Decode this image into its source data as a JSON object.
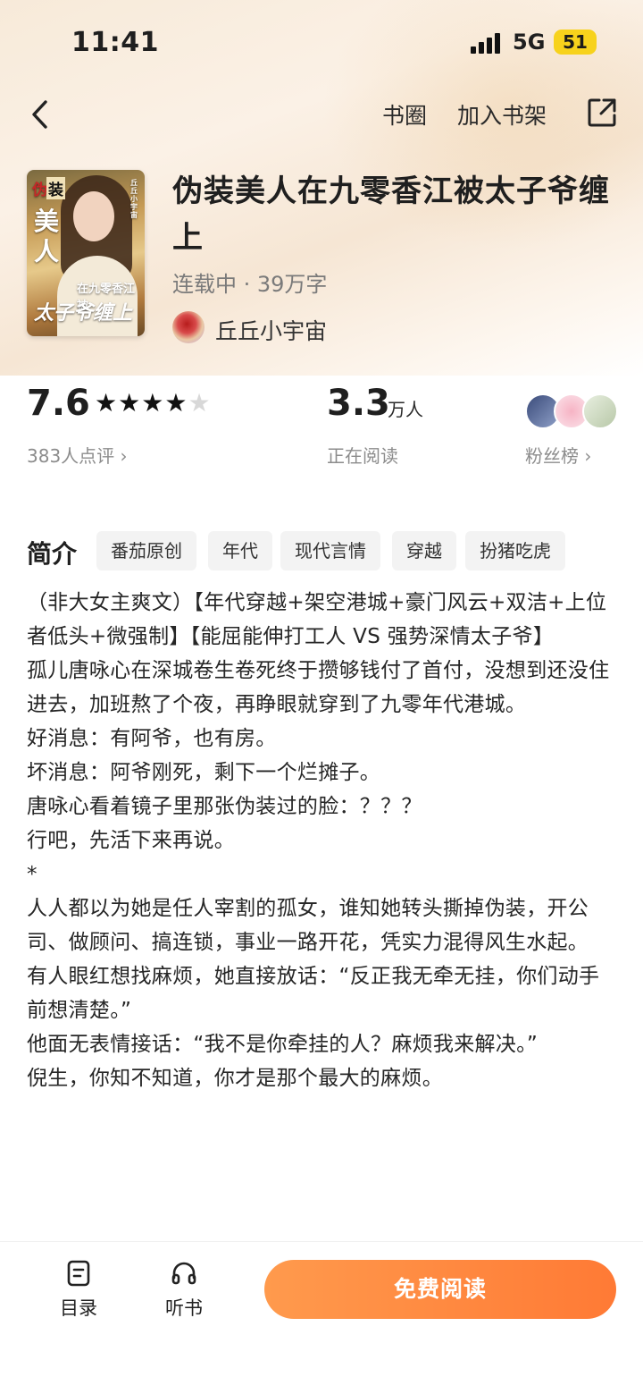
{
  "status_bar": {
    "time": "11:41",
    "network": "5G",
    "battery": "51"
  },
  "nav": {
    "circle_label": "书圈",
    "add_shelf_label": "加入书架"
  },
  "cover": {
    "line1": "伪",
    "line2": "装",
    "line3": "美",
    "line4": "人",
    "subtitle": "在九零香江被",
    "main": "太子爷缠上",
    "author_mark": "丘丘小宇宙"
  },
  "book": {
    "title": "伪装美人在九零香江被太子爷缠上",
    "meta": "连载中 · 39万字",
    "author": "丘丘小宇宙"
  },
  "stats": {
    "score": "7.6",
    "rating_stars": 4,
    "rating_count": "383人点评 ›",
    "readers": "3.3",
    "readers_unit": "万人",
    "readers_label": "正在阅读",
    "fans_label": "粉丝榜 ›"
  },
  "intro": {
    "title": "简介",
    "tags": [
      "番茄原创",
      "年代",
      "现代言情",
      "穿越",
      "扮猪吃虎"
    ],
    "paragraphs": [
      "（非大女主爽文）【年代穿越+架空港城+豪门风云+双洁+上位者低头+微强制】【能屈能伸打工人 VS 强势深情太子爷】",
      "孤儿唐咏心在深城卷生卷死终于攒够钱付了首付，没想到还没住进去，加班熬了个夜，再睁眼就穿到了九零年代港城。",
      "好消息：有阿爷，也有房。",
      "坏消息：阿爷刚死，剩下一个烂摊子。",
      "唐咏心看着镜子里那张伪装过的脸：？？？",
      "行吧，先活下来再说。",
      "*",
      "人人都以为她是任人宰割的孤女，谁知她转头撕掉伪装，开公司、做顾问、搞连锁，事业一路开花，凭实力混得风生水起。",
      "有人眼红想找麻烦，她直接放话：“反正我无牵无挂，你们动手前想清楚。”",
      "他面无表情接话：“我不是你牵挂的人？麻烦我来解决。”",
      "倪生，你知不知道，你才是那个最大的麻烦。"
    ]
  },
  "bottom": {
    "catalog_label": "目录",
    "listen_label": "听书",
    "read_label": "免费阅读"
  },
  "colors": {
    "accent": "#ff7a35",
    "accent_light": "#ff9a4d",
    "battery": "#f7d21c"
  }
}
